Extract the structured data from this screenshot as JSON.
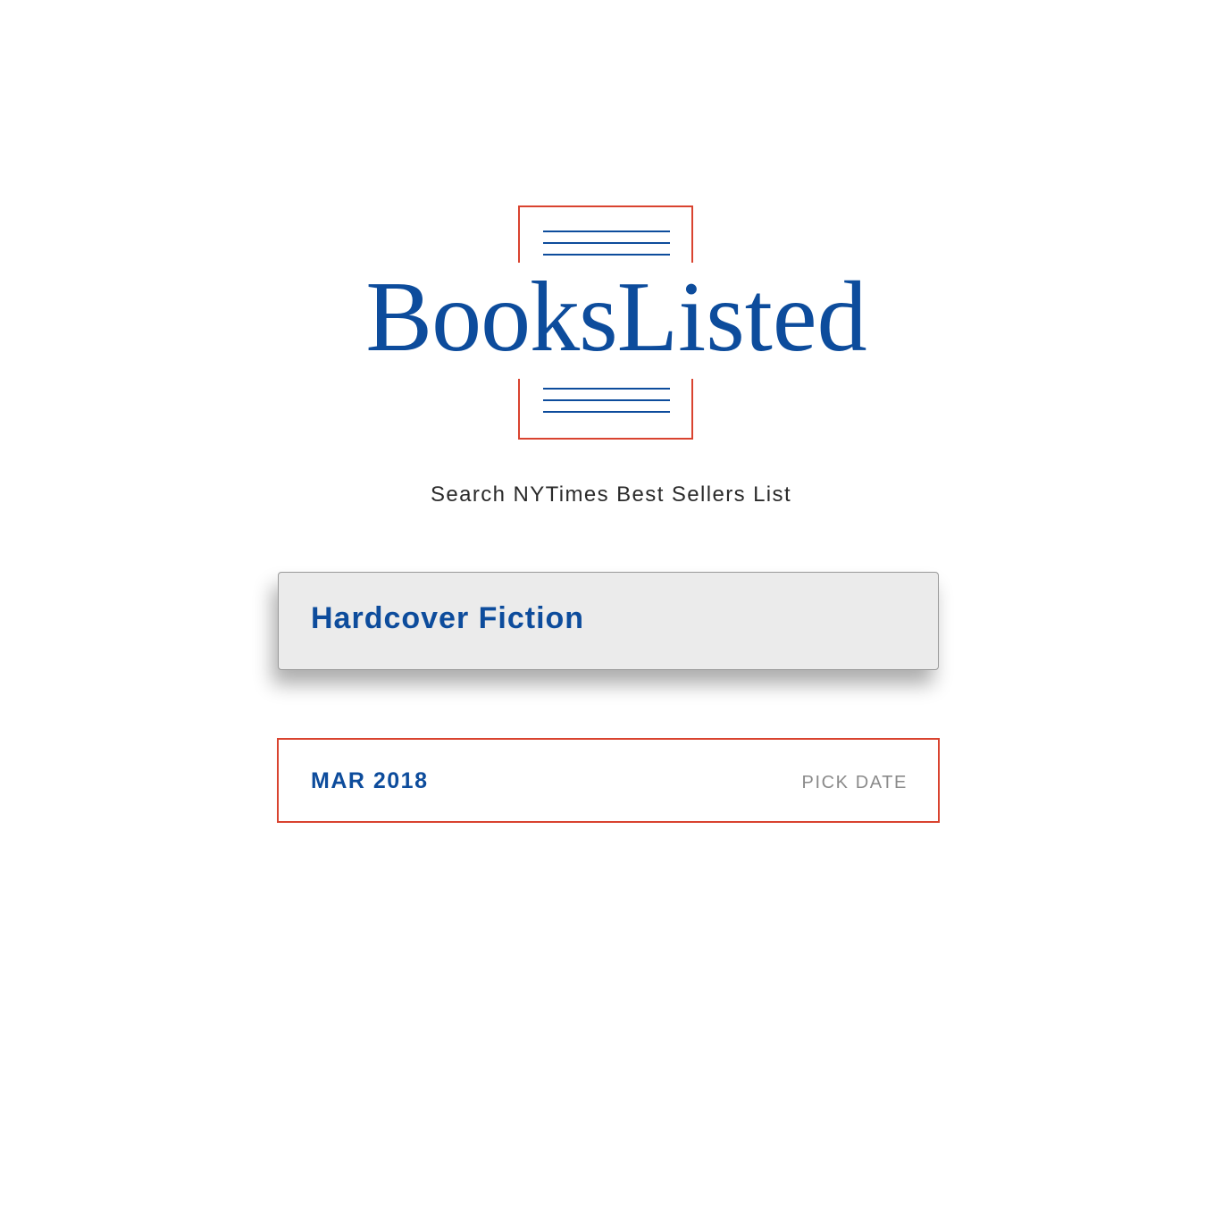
{
  "logo": {
    "word1": "Books",
    "word2": "Listed"
  },
  "colors": {
    "brand_blue": "#0d4c9c",
    "accent_red": "#d9432f",
    "box_gray": "#ebebeb"
  },
  "subtitle": "Search NYTimes Best Sellers List",
  "category_selector": {
    "value": "Hardcover Fiction"
  },
  "date_selector": {
    "value": "MAR 2018",
    "action_label": "PICK DATE"
  }
}
